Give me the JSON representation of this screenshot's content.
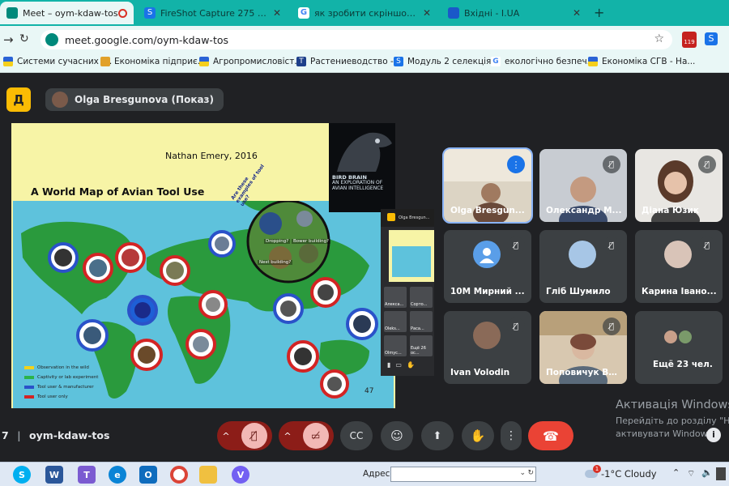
{
  "browser": {
    "tabs": [
      {
        "label": "Meet – oym-kdaw-tos",
        "icon": "meet-icon",
        "active": true,
        "extra": "recording-icon"
      },
      {
        "label": "FireShot Capture 275 - Meet – о",
        "icon": "fireshot-icon"
      },
      {
        "label": "як зробити скріншот на ноутбу",
        "icon": "google-icon"
      },
      {
        "label": "Вхідні - I.UA",
        "icon": "iua-icon"
      }
    ],
    "new_tab": "+",
    "url": "meet.google.com/oym-kdaw-tos",
    "ext_badge": "119",
    "bookmarks": [
      {
        "label": "Системи сучасних і...",
        "icon": "ua-flag-icon"
      },
      {
        "label": "Економіка підприє...",
        "icon": "book-icon"
      },
      {
        "label": "Агропромисловіст...",
        "icon": "ua-flag-icon"
      },
      {
        "label": "Растениеводство -...",
        "icon": "t-icon"
      },
      {
        "label": "Модуль 2 селекція...",
        "icon": "s-icon"
      },
      {
        "label": "екологічно безпеч...",
        "icon": "google-icon"
      },
      {
        "label": "Економіка СГВ - На...",
        "icon": "ua-flag-icon"
      }
    ]
  },
  "meet": {
    "logo_letter": "Д",
    "presenter_label": "Olga Bresgunova (Показ)",
    "meeting_code": "oym-kdaw-tos",
    "meeting_prefix": "7",
    "slide": {
      "author": "Nathan Emery, 2016",
      "title": "A World Map of Avian Tool Use",
      "book_title": "BIRD BRAIN",
      "book_subtitle": "AN EXPLORATION OF AVIAN INTELLIGENCE",
      "question": "Are these examples of tool use?",
      "circle_labels": [
        "Dropping?",
        "Nest building?",
        "Bower building?"
      ],
      "legend": [
        {
          "label": "Observation in the wild",
          "color": "#f2d21a"
        },
        {
          "label": "Captivity or lab experiment",
          "color": "#2bb34a"
        },
        {
          "label": "Tool user & manufacturer",
          "color": "#2a52c9"
        },
        {
          "label": "Tool user only",
          "color": "#d32424"
        }
      ],
      "page_number": "47"
    },
    "pip": {
      "title": "Olga Bresgun...",
      "minis": [
        "Алекса...",
        "Сорто...",
        "Oleks...",
        "Раса...",
        "Olmyc...",
        "Ещё 26 ос..."
      ]
    },
    "participants": [
      {
        "name": "Olga Bresgun...",
        "speaking": true
      },
      {
        "name": "Олександр М...",
        "muted": true
      },
      {
        "name": "Діана Юзик",
        "muted": true
      },
      {
        "name": "10M Мирний ...",
        "muted": true,
        "avatar": "generic"
      },
      {
        "name": "Гліб Шумило",
        "muted": true
      },
      {
        "name": "Карина Івано...",
        "muted": true
      },
      {
        "name": "Ivan Volodin",
        "muted": true
      },
      {
        "name": "Поповичук Ва...",
        "muted": true
      },
      {
        "name": "Ещё 23 чел.",
        "more": true
      }
    ]
  },
  "windows": {
    "activation_title": "Активація Windows",
    "activation_text_1": "Перейдіть до розділу \"На",
    "activation_text_2": "активувати Windows.",
    "address_label": "Адреса",
    "weather": "-1°C  Cloudy",
    "weather_badge": "1"
  }
}
